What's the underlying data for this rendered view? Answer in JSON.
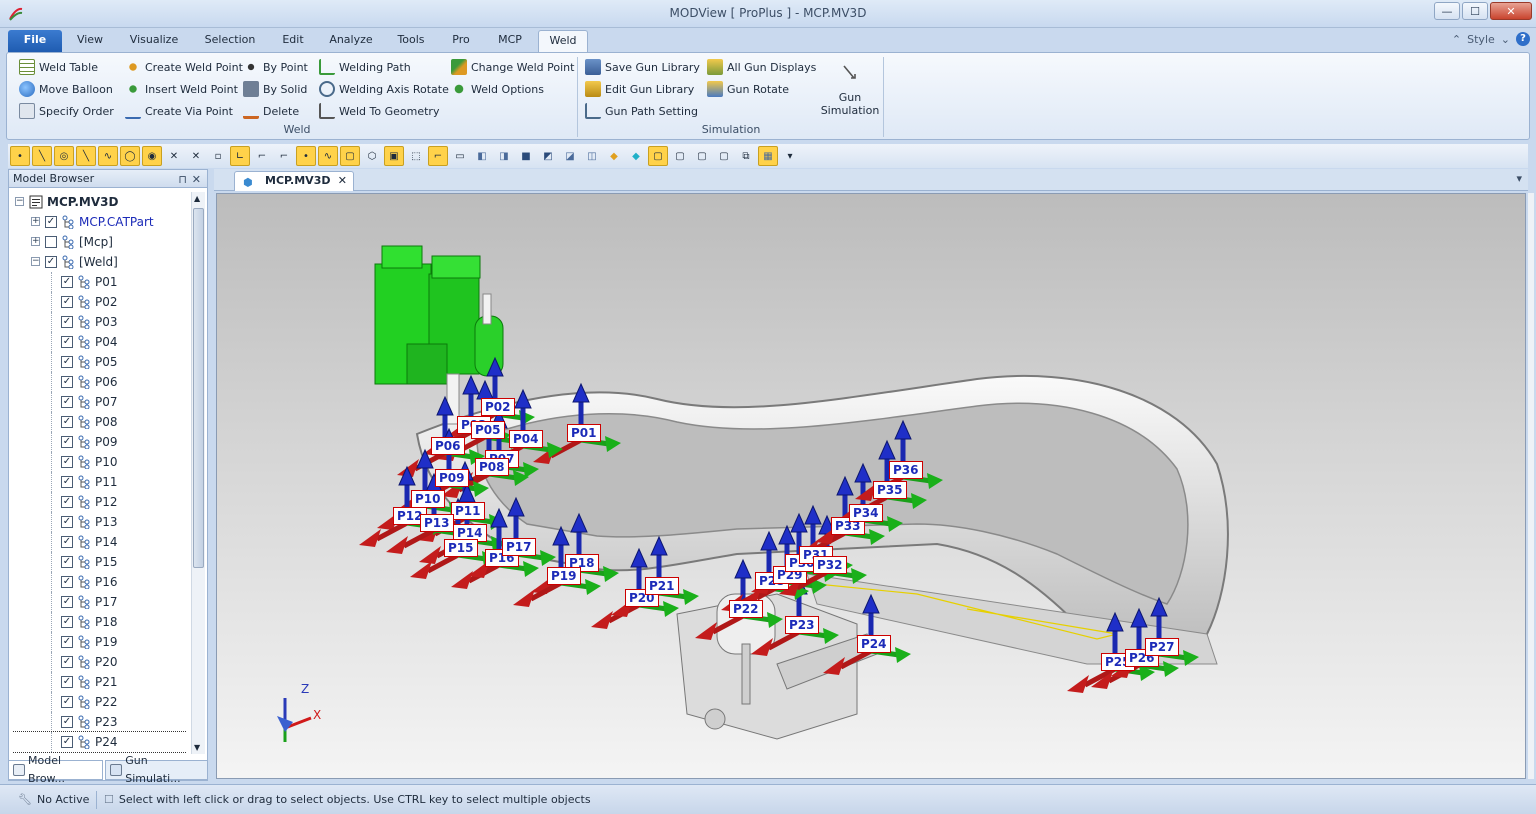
{
  "window": {
    "title": "MODView [ ProPlus ] - MCP.MV3D",
    "minimize": "—",
    "maximize": "☐",
    "close": "✕"
  },
  "ribbon": {
    "tabs": [
      "File",
      "View",
      "Visualize",
      "Selection",
      "Edit",
      "Analyze",
      "Tools",
      "Pro",
      "MCP",
      "Weld"
    ],
    "active_tab": "Weld",
    "style_label": "Style",
    "help": "?",
    "weld_group": {
      "label": "Weld",
      "weld_table": "Weld Table",
      "move_balloon": "Move Balloon",
      "specify_order": "Specify Order",
      "create_weld_point": "Create Weld Point",
      "insert_weld_point": "Insert Weld Point",
      "create_via_point": "Create Via Point",
      "by_point": "By Point",
      "by_solid": "By Solid",
      "delete": "Delete",
      "welding_path": "Welding Path",
      "welding_axis_rotate": "Welding Axis Rotate",
      "weld_to_geometry": "Weld To Geometry",
      "change_weld_point": "Change Weld Point",
      "weld_options": "Weld Options"
    },
    "simulation_group": {
      "label": "Simulation",
      "save_gun_library": "Save Gun Library",
      "edit_gun_library": "Edit Gun Library",
      "gun_path_setting": "Gun Path Setting",
      "all_gun_displays": "All Gun Displays",
      "gun_rotate": "Gun Rotate",
      "gun_simulation_line1": "Gun",
      "gun_simulation_line2": "Simulation"
    }
  },
  "model_browser": {
    "title": "Model Browser",
    "pin": "ᵖ",
    "close": "✕",
    "root": "MCP.MV3D",
    "nodes": [
      {
        "label": "MCP.CATPart",
        "checked": true
      },
      {
        "label": "[Mcp]",
        "checked": false
      },
      {
        "label": "[Weld]",
        "checked": true
      }
    ],
    "points": [
      "P01",
      "P02",
      "P03",
      "P04",
      "P05",
      "P06",
      "P07",
      "P08",
      "P09",
      "P10",
      "P11",
      "P12",
      "P13",
      "P14",
      "P15",
      "P16",
      "P17",
      "P18",
      "P19",
      "P20",
      "P21",
      "P22",
      "P23",
      "P24"
    ],
    "bottom_tabs": [
      "Model Brow...",
      "Gun Simulati..."
    ]
  },
  "document": {
    "tab_title": "MCP.MV3D",
    "tab_close": "✕",
    "dropdown": "▾"
  },
  "viewport": {
    "weld_labels": [
      "P01",
      "P02",
      "P03",
      "P04",
      "P05",
      "P06",
      "P07",
      "P08",
      "P09",
      "P10",
      "P11",
      "P12",
      "P13",
      "P14",
      "P15",
      "P16",
      "P17",
      "P18",
      "P19",
      "P20",
      "P21",
      "P22",
      "P23",
      "P24",
      "P25",
      "P26",
      "P27",
      "P28",
      "P29",
      "P30",
      "P31",
      "P32",
      "P33",
      "P34",
      "P35",
      "P36"
    ],
    "axes": {
      "z": "Z",
      "x": "X"
    }
  },
  "status": {
    "mode": "No Active",
    "hint": "Select with left click or drag to select objects. Use CTRL key to select multiple objects"
  },
  "colors": {
    "accent": "#1f5cb1",
    "label_border": "#cc0000",
    "label_text": "#1c2bb8"
  }
}
